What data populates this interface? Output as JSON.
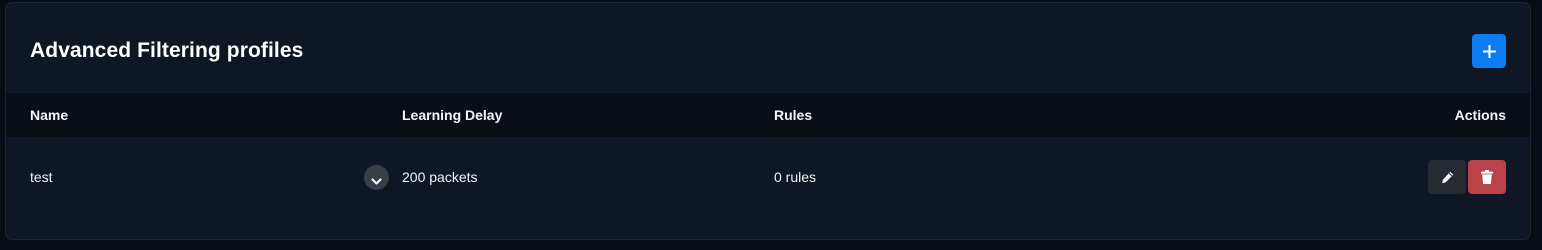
{
  "panel": {
    "title": "Advanced Filtering profiles",
    "add_label": "+"
  },
  "table": {
    "columns": {
      "name": "Name",
      "learning_delay": "Learning Delay",
      "rules": "Rules",
      "actions": "Actions"
    },
    "rows": [
      {
        "name": "test",
        "learning_delay": "200 packets",
        "rules": "0 rules"
      }
    ]
  },
  "icons": {
    "add": "plus-icon",
    "expand": "chevron-down-icon",
    "edit": "pencil-icon",
    "delete": "trash-icon"
  },
  "colors": {
    "accent": "#0d7cf2",
    "danger": "#bc4249",
    "card_bg": "#0f1626",
    "header_row_bg": "#0a0e17"
  }
}
